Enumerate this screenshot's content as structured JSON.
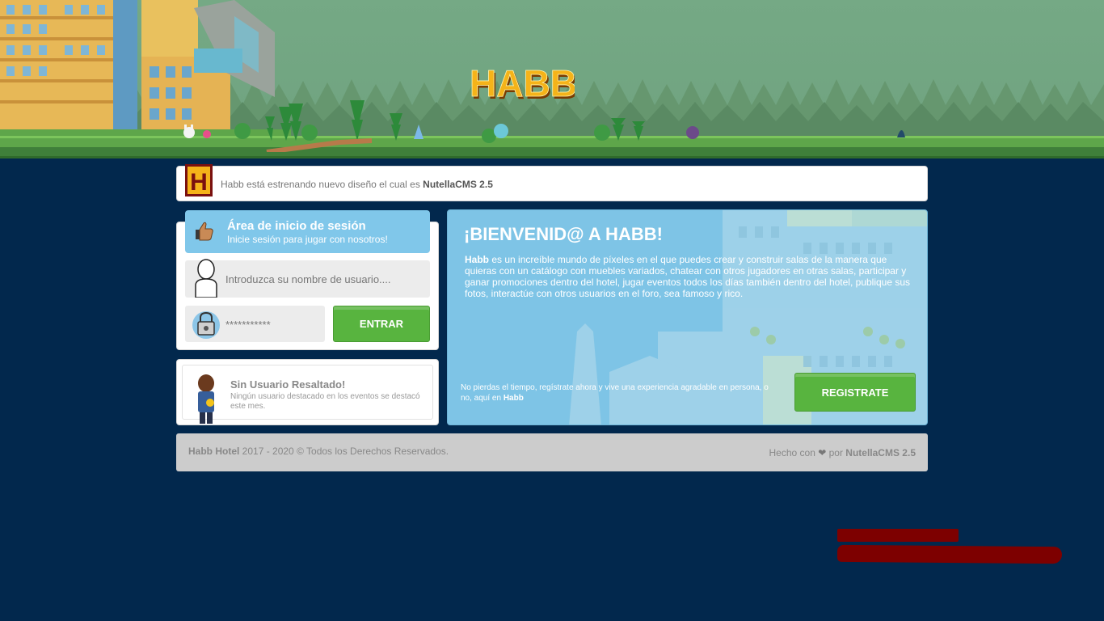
{
  "header": {
    "logo_text": "HABB",
    "logo_icon": "habb-logo"
  },
  "notice": {
    "badge_letter": "H",
    "prefix": "Habb está estrenando nuevo diseño el cual es ",
    "highlight": "NutellaCMS 2.5"
  },
  "login": {
    "title": "Área de inicio de sesión",
    "subtitle": "Inicie sesión para jugar con nosotros!",
    "thumb_icon": "thumbs-up-icon",
    "username_placeholder": "Introduzca su nombre de usuario....",
    "password_placeholder": "***********",
    "user_icon": "user-silhouette-icon",
    "lock_icon": "lock-icon",
    "submit_label": "ENTRAR"
  },
  "featured": {
    "title": "Sin Usuario Resaltado!",
    "subtitle": "Ningún usuario destacado en los eventos se destacó este mes."
  },
  "welcome": {
    "title": "¡BIENVENID@ A HABB!",
    "body_brand": "Habb",
    "body_text": " es un increíble mundo de píxeles en el que puedes crear y construir salas de la manera que quieras con un catálogo con muebles variados, chatear con otros jugadores en otras salas, participar y ganar promociones dentro del hotel, jugar eventos todos los días también dentro del hotel, publique sus fotos, interactúe con otros usuarios en el foro, sea famoso y rico.",
    "footer_text": "No pierdas el tiempo, regístrate ahora y vive una experiencia agradable en persona, o no, aquí en ",
    "footer_brand": "Habb",
    "register_label": "REGISTRATE"
  },
  "footer": {
    "brand": "Habb Hotel",
    "copyright": " 2017 - 2020 © Todos los Derechos Reservados.",
    "made_with": "Hecho con ",
    "heart_icon": "heart-icon",
    "by": " por ",
    "cms": "NutellaCMS 2.5"
  },
  "colors": {
    "page_bg": "#02284d",
    "header_bg": "#74a883",
    "accent_blue": "#80c7ea",
    "button_green": "#58b43f",
    "redaction": "#7d0000"
  }
}
